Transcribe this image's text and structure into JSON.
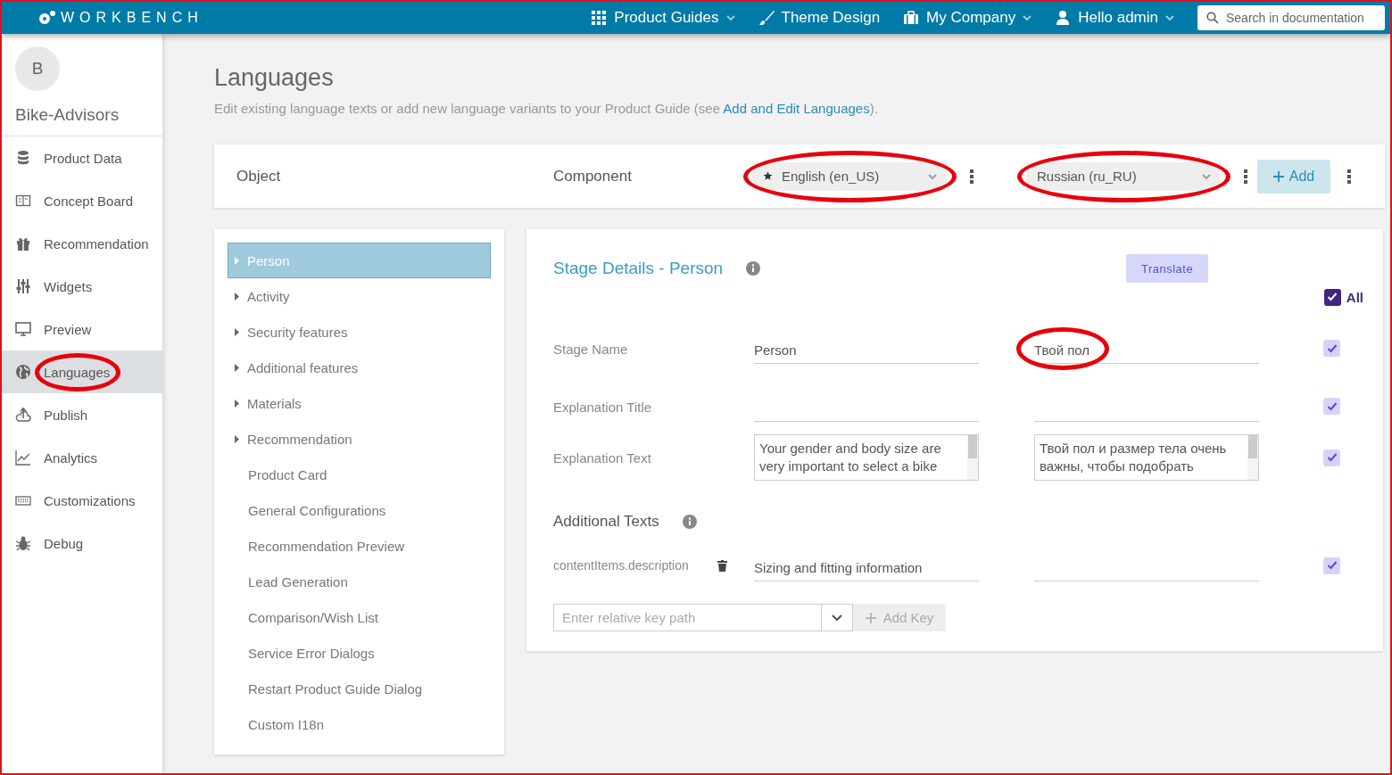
{
  "topbar": {
    "logo": "WORKBENCH",
    "nav": [
      {
        "label": "Product Guides",
        "dropdown": true
      },
      {
        "label": "Theme Design",
        "dropdown": false
      },
      {
        "label": "My Company",
        "dropdown": true
      },
      {
        "label": "Hello admin",
        "dropdown": true
      }
    ],
    "search": {
      "placeholder": "Search in documentation"
    }
  },
  "sidebar": {
    "avatar": "B",
    "account": "Bike-Advisors",
    "items": [
      {
        "label": "Product Data",
        "selected": false,
        "circled": false
      },
      {
        "label": "Concept Board",
        "selected": false,
        "circled": false
      },
      {
        "label": "Recommendation",
        "selected": false,
        "circled": false
      },
      {
        "label": "Widgets",
        "selected": false,
        "circled": false
      },
      {
        "label": "Preview",
        "selected": false,
        "circled": false
      },
      {
        "label": "Languages",
        "selected": true,
        "circled": true
      },
      {
        "label": "Publish",
        "selected": false,
        "circled": false
      },
      {
        "label": "Analytics",
        "selected": false,
        "circled": false
      },
      {
        "label": "Customizations",
        "selected": false,
        "circled": false
      },
      {
        "label": "Debug",
        "selected": false,
        "circled": false
      }
    ]
  },
  "page": {
    "title": "Languages",
    "description": {
      "before": "Edit existing language texts or add new language variants to your Product Guide (see ",
      "link": "Add and Edit Languages",
      "after": ")."
    }
  },
  "toolbar": {
    "columns": [
      "Object",
      "Component"
    ],
    "languages": [
      {
        "label": "English (en_US)",
        "default": true,
        "circled": true
      },
      {
        "label": "Russian (ru_RU)",
        "default": false,
        "circled": true
      }
    ],
    "add_button": "Add"
  },
  "tree": [
    {
      "label": "Person",
      "expandable": true,
      "selected": true
    },
    {
      "label": "Activity",
      "expandable": true,
      "selected": false
    },
    {
      "label": "Security features",
      "expandable": true,
      "selected": false
    },
    {
      "label": "Additional features",
      "expandable": true,
      "selected": false
    },
    {
      "label": "Materials",
      "expandable": true,
      "selected": false
    },
    {
      "label": "Recommendation",
      "expandable": true,
      "selected": false
    },
    {
      "label": "Product Card",
      "expandable": false,
      "selected": false
    },
    {
      "label": "General Configurations",
      "expandable": false,
      "selected": false
    },
    {
      "label": "Recommendation Preview",
      "expandable": false,
      "selected": false
    },
    {
      "label": "Lead Generation",
      "expandable": false,
      "selected": false
    },
    {
      "label": "Comparison/Wish List",
      "expandable": false,
      "selected": false
    },
    {
      "label": "Service Error Dialogs",
      "expandable": false,
      "selected": false
    },
    {
      "label": "Restart Product Guide Dialog",
      "expandable": false,
      "selected": false
    },
    {
      "label": "Custom I18n",
      "expandable": false,
      "selected": false
    }
  ],
  "details": {
    "title": "Stage Details - Person",
    "translate_button": "Translate",
    "all": {
      "label": "All",
      "checked": true
    },
    "fields": [
      {
        "label": "Stage Name",
        "kind": "input",
        "source": "Person",
        "target": "Твой пол",
        "target_circled": true,
        "checked": true
      },
      {
        "label": "Explanation Title",
        "kind": "input",
        "checked": true
      },
      {
        "label": "Explanation Text",
        "kind": "textarea",
        "source": "Your gender and body size are very important to select a bike",
        "target": "Твой пол и размер тела очень важны, чтобы подобрать",
        "checked": true
      }
    ],
    "additional": {
      "title": "Additional Texts",
      "items": [
        {
          "key": "contentItems.description",
          "source": "Sizing and fitting information",
          "checked": true
        }
      ],
      "key_field": {
        "placeholder": "Enter relative key path"
      },
      "add_key_button": "Add Key"
    }
  }
}
